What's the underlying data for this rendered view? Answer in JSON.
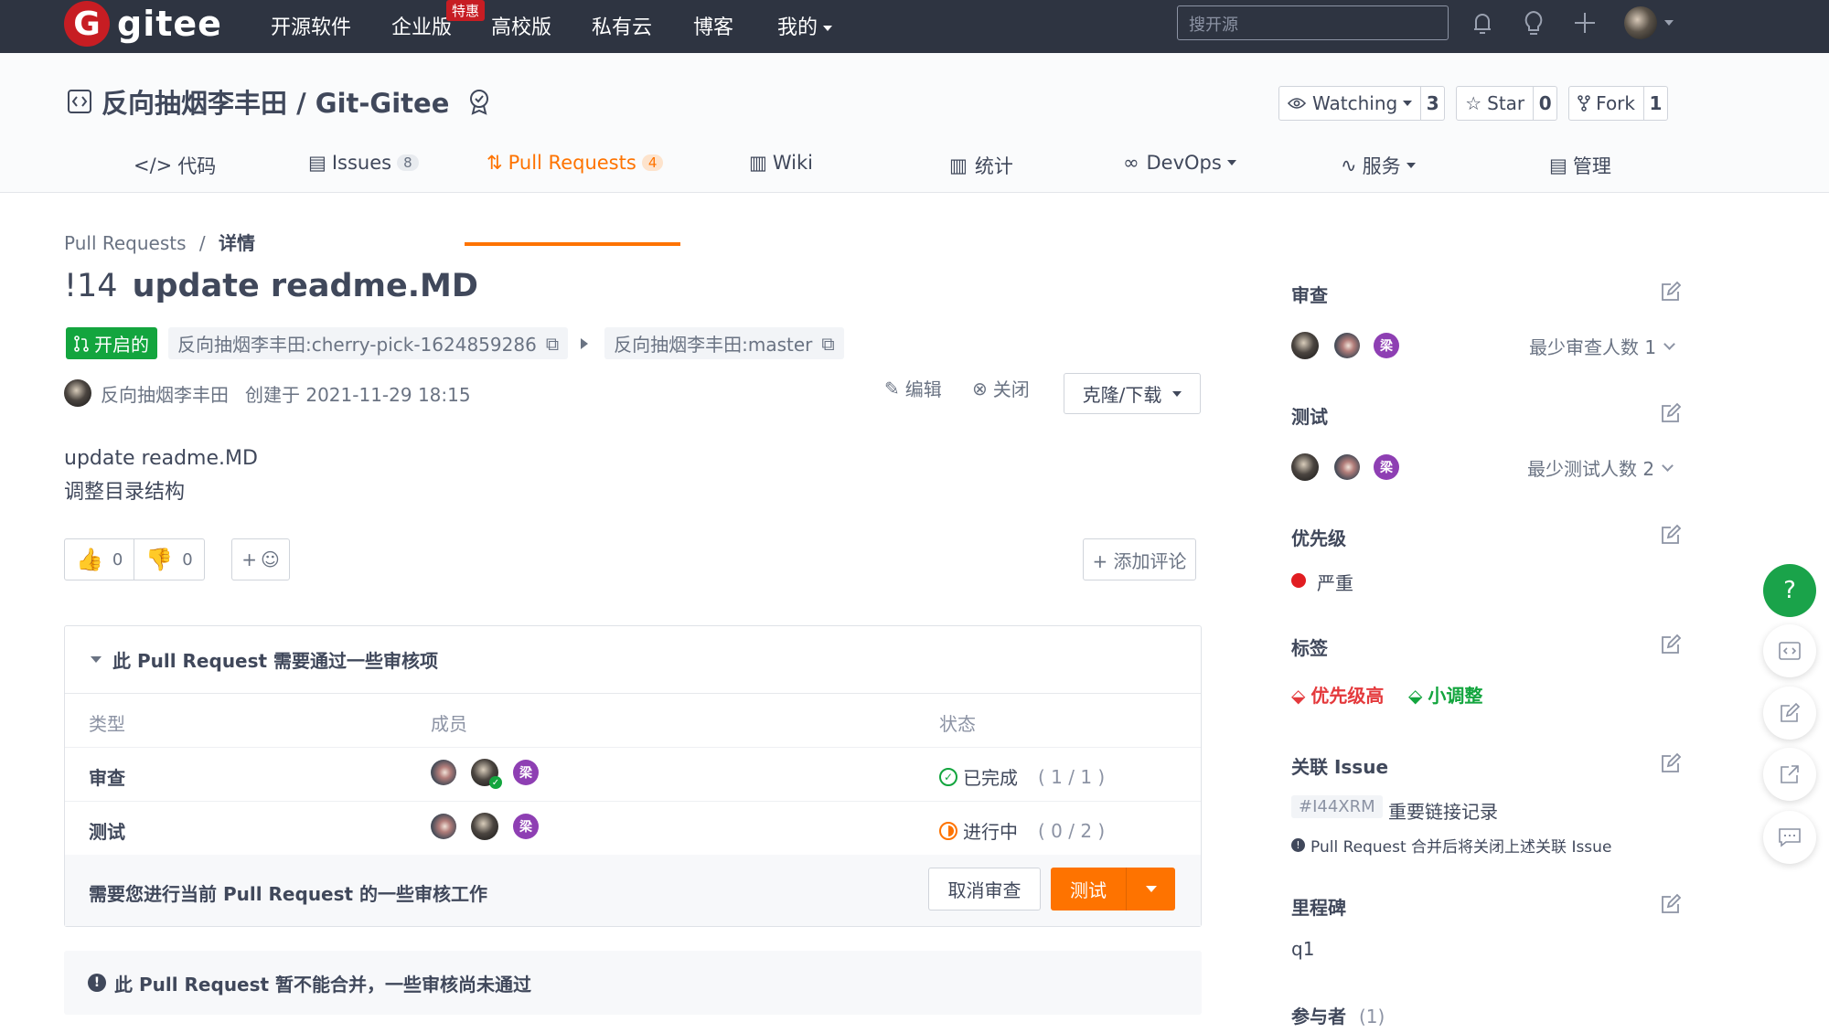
{
  "navbar": {
    "logo_text": "gitee",
    "logo_letter": "G",
    "items": [
      "开源软件",
      "企业版",
      "高校版",
      "私有云",
      "博客",
      "我的"
    ],
    "hot_badge": "特惠",
    "search_placeholder": "搜开源"
  },
  "repo": {
    "title": "反向抽烟李丰田 / Git-Gitee",
    "watching_label": "Watching",
    "watching_count": "3",
    "star_label": "Star",
    "star_count": "0",
    "fork_label": "Fork",
    "fork_count": "1"
  },
  "tabs": [
    {
      "label": "代码"
    },
    {
      "label": "Issues",
      "badge": "8"
    },
    {
      "label": "Pull Requests",
      "badge": "4"
    },
    {
      "label": "Wiki"
    },
    {
      "label": "统计"
    },
    {
      "label": "DevOps"
    },
    {
      "label": "服务"
    },
    {
      "label": "管理"
    }
  ],
  "breadcrumb": {
    "parent": "Pull Requests",
    "separator": "/",
    "current": "详情"
  },
  "pr": {
    "number": "!14",
    "title": "update readme.MD",
    "status": "开启的",
    "source_branch": "反向抽烟李丰田:cherry-pick-1624859286",
    "target_branch": "反向抽烟李丰田:master",
    "author": "反向抽烟李丰田",
    "created": "创建于 2021-11-29 18:15",
    "edit_label": "编辑",
    "close_label": "关闭",
    "clone_label": "克隆/下载",
    "body_lines": [
      "update readme.MD",
      "调整目录结构"
    ],
    "thumbs_up": "0",
    "thumbs_down": "0",
    "emoji_add": "+",
    "add_comment": "+ 添加评论"
  },
  "review": {
    "header": "此 Pull Request 需要通过一些审核项",
    "columns": [
      "类型",
      "成员",
      "状态"
    ],
    "rows": [
      {
        "type": "审查",
        "status": "已完成",
        "progress": "( 1 / 1 )"
      },
      {
        "type": "测试",
        "status": "进行中",
        "progress": "( 0 / 2 )"
      }
    ],
    "footer_msg": "需要您进行当前 Pull Request 的一些审核工作",
    "cancel_label": "取消审查",
    "test_label": "测试",
    "member_avatar_letter": "梁"
  },
  "warning": "此 Pull Request 暂不能合并，一些审核尚未通过",
  "sidebar": {
    "review_title": "审查",
    "review_min": "最少审查人数 1",
    "test_title": "测试",
    "test_min": "最少测试人数 2",
    "priority_title": "优先级",
    "priority_value": "严重",
    "labels_title": "标签",
    "labels": [
      "优先级高",
      "小调整"
    ],
    "issue_title": "关联 Issue",
    "issue_id": "#I44XRM",
    "issue_name": "重要链接记录",
    "issue_note": "Pull Request 合并后将关闭上述关联 Issue",
    "milestone_title": "里程碑",
    "milestone_value": "q1",
    "participants_title": "参与者",
    "participants_count": "(1)"
  },
  "colors": {
    "navbar_bg": "#2e3441",
    "accent_orange": "#fe7300",
    "open_green": "#13a53e",
    "brand_red": "#c71d23",
    "danger_red": "#e11d21",
    "label_red": "#e4393c",
    "label_green": "#13a53e",
    "help_green": "#1aa34a",
    "avatar_purple": "#8e3fb3"
  },
  "icons": {
    "floating": [
      "help-icon",
      "code-icon",
      "edit-icon",
      "share-icon",
      "chat-icon"
    ]
  }
}
